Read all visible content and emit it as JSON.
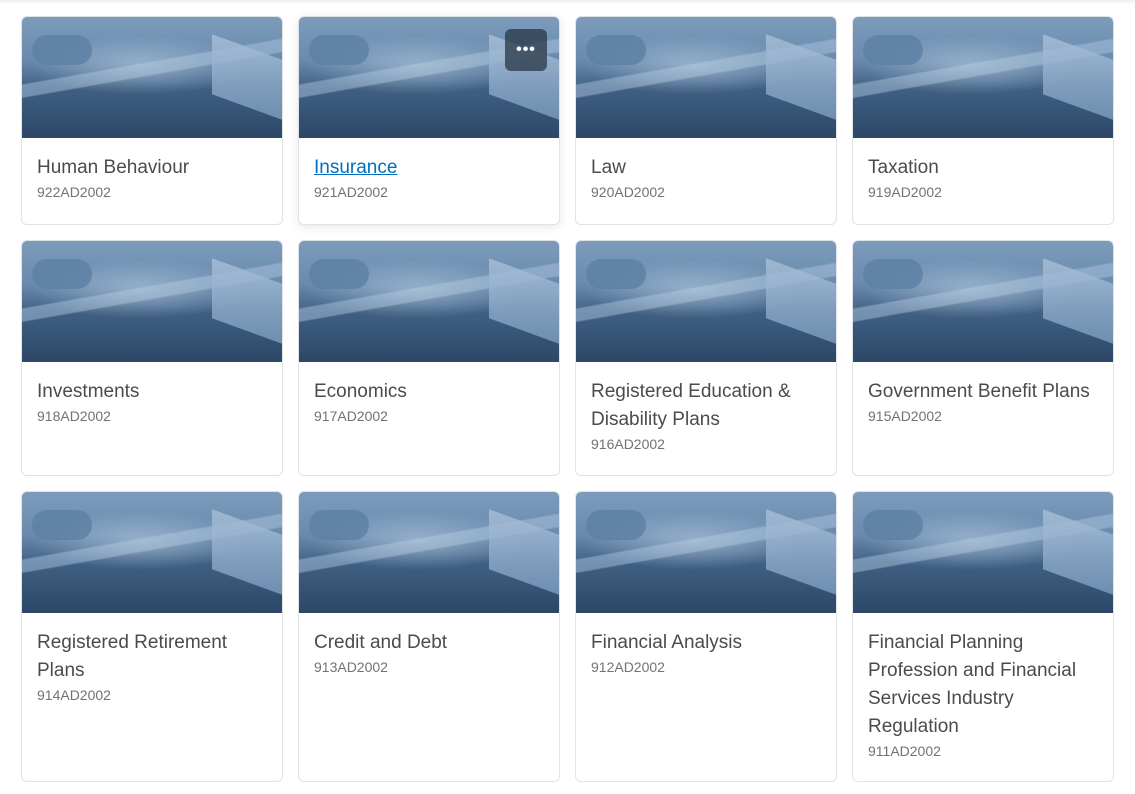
{
  "courses": [
    {
      "title": "Human Behaviour",
      "code": "922AD2002"
    },
    {
      "title": "Insurance",
      "code": "921AD2002",
      "hovered": true
    },
    {
      "title": "Law",
      "code": "920AD2002"
    },
    {
      "title": "Taxation",
      "code": "919AD2002"
    },
    {
      "title": "Investments",
      "code": "918AD2002"
    },
    {
      "title": "Economics",
      "code": "917AD2002"
    },
    {
      "title": "Registered Education & Disability Plans",
      "code": "916AD2002"
    },
    {
      "title": "Government Benefit Plans",
      "code": "915AD2002"
    },
    {
      "title": "Registered Retirement Plans",
      "code": "914AD2002"
    },
    {
      "title": "Credit and Debt",
      "code": "913AD2002"
    },
    {
      "title": "Financial Analysis",
      "code": "912AD2002"
    },
    {
      "title": "Financial Planning Profession and Financial Services Industry Regulation",
      "code": "911AD2002"
    }
  ],
  "more_options_label": "•••",
  "colors": {
    "link": "#006fbf",
    "title": "#494c4e",
    "code": "#6e7376"
  }
}
